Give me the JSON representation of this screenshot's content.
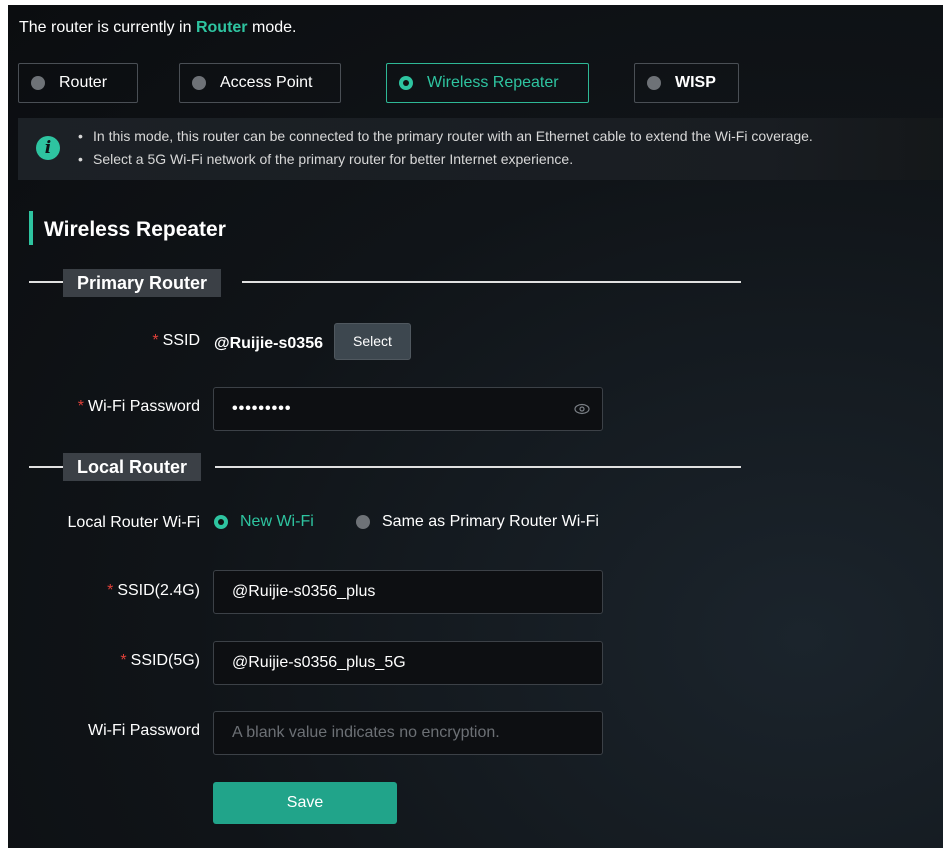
{
  "status": {
    "prefix": "The router is currently in",
    "mode": "Router",
    "suffix": "mode."
  },
  "modes": [
    {
      "label": "Router",
      "selected": false
    },
    {
      "label": "Access Point",
      "selected": false
    },
    {
      "label": "Wireless Repeater",
      "selected": true
    },
    {
      "label": "WISP",
      "selected": false
    }
  ],
  "info": {
    "lines": [
      "In this mode, this router can be connected to the primary router with an Ethernet cable to extend the Wi-Fi coverage.",
      "Select a 5G Wi-Fi network of the primary router for better Internet experience."
    ]
  },
  "section_title": "Wireless Repeater",
  "primary": {
    "heading": "Primary Router",
    "ssid_label": "SSID",
    "ssid_value": "@Ruijie-s0356",
    "select_label": "Select",
    "password_label": "Wi-Fi Password",
    "password_mask": "•••••••••"
  },
  "local": {
    "heading": "Local Router",
    "wifi_label": "Local Router Wi-Fi",
    "wifi_options": [
      {
        "label": "New Wi-Fi",
        "selected": true
      },
      {
        "label": "Same as Primary Router Wi-Fi",
        "selected": false
      }
    ],
    "ssid24_label": "SSID(2.4G)",
    "ssid24_value": "@Ruijie-s0356_plus",
    "ssid5_label": "SSID(5G)",
    "ssid5_value": "@Ruijie-s0356_plus_5G",
    "password_label": "Wi-Fi Password",
    "password_placeholder": "A blank value indicates no encryption."
  },
  "save_label": "Save",
  "colors": {
    "accent": "#2ec4a0",
    "required": "#e0413a",
    "save_button": "#21a48a"
  },
  "icons": {
    "info": "info-icon",
    "password_visibility": "eye-icon"
  }
}
